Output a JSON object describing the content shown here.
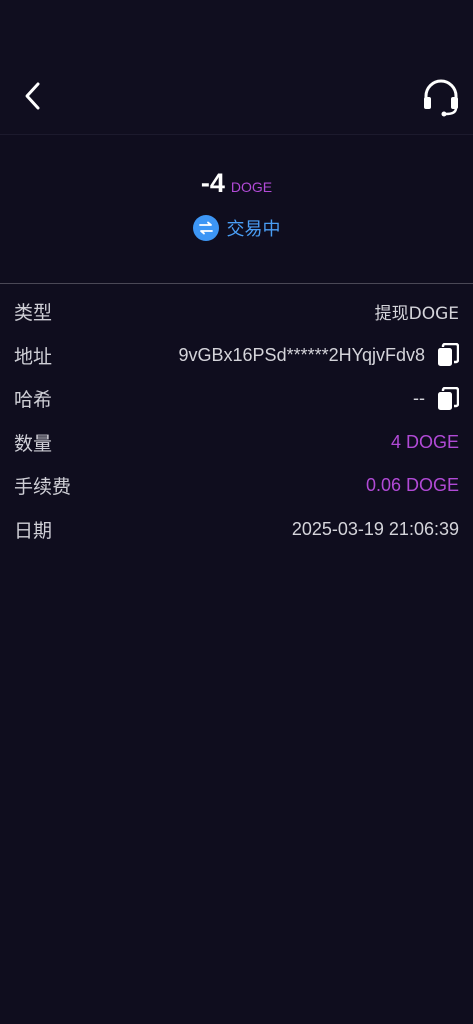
{
  "header": {
    "back_icon": "chevron-left-icon",
    "support_icon": "headset-icon"
  },
  "summary": {
    "amount": "-4",
    "unit": "DOGE",
    "status_text": "交易中",
    "status_icon": "exchange-icon",
    "status_color": "#4a9ef5",
    "accent_color": "#b14ad6"
  },
  "details": {
    "type_label": "类型",
    "type_value": "提现DOGE",
    "address_label": "地址",
    "address_value": "9vGBx16PSd******2HYqjvFdv8",
    "hash_label": "哈希",
    "hash_value": "--",
    "quantity_label": "数量",
    "quantity_value": "4 DOGE",
    "fee_label": "手续费",
    "fee_value": "0.06 DOGE",
    "date_label": "日期",
    "date_value": "2025-03-19 21:06:39"
  }
}
